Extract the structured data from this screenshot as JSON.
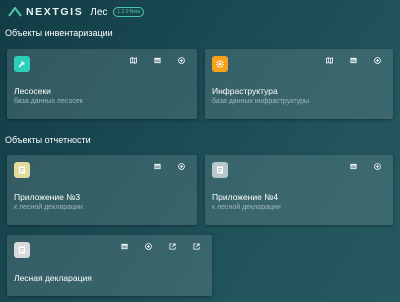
{
  "header": {
    "logo_text": "NEXTGIS",
    "app_name": "Лес",
    "version": "1.2.0 Beta"
  },
  "sections": [
    {
      "title": "Объекты инвентаризации"
    },
    {
      "title": "Объекты отчетности"
    }
  ],
  "cards": [
    {
      "title": "Лесосеки",
      "subtitle": "база данных лесосек",
      "icon": "axe-icon",
      "icon_color": "#2ecfb8"
    },
    {
      "title": "Инфраструктура",
      "subtitle": "база данных инфраструктуры",
      "icon": "gear-icon",
      "icon_color": "#f6a21d"
    },
    {
      "title": "Приложение №3",
      "subtitle": "к лесной декларации",
      "icon": "document-icon",
      "icon_color": "#e2dc9a"
    },
    {
      "title": "Приложение №4",
      "subtitle": "к лесной декларации",
      "icon": "document-icon",
      "icon_color": "#b8c7cb"
    },
    {
      "title": "Лесная декларация",
      "subtitle": "",
      "icon": "document-icon",
      "icon_color": "#d9d9d9"
    }
  ],
  "colors": {
    "accent": "#4fc3a8",
    "background": "#1a4a52"
  }
}
